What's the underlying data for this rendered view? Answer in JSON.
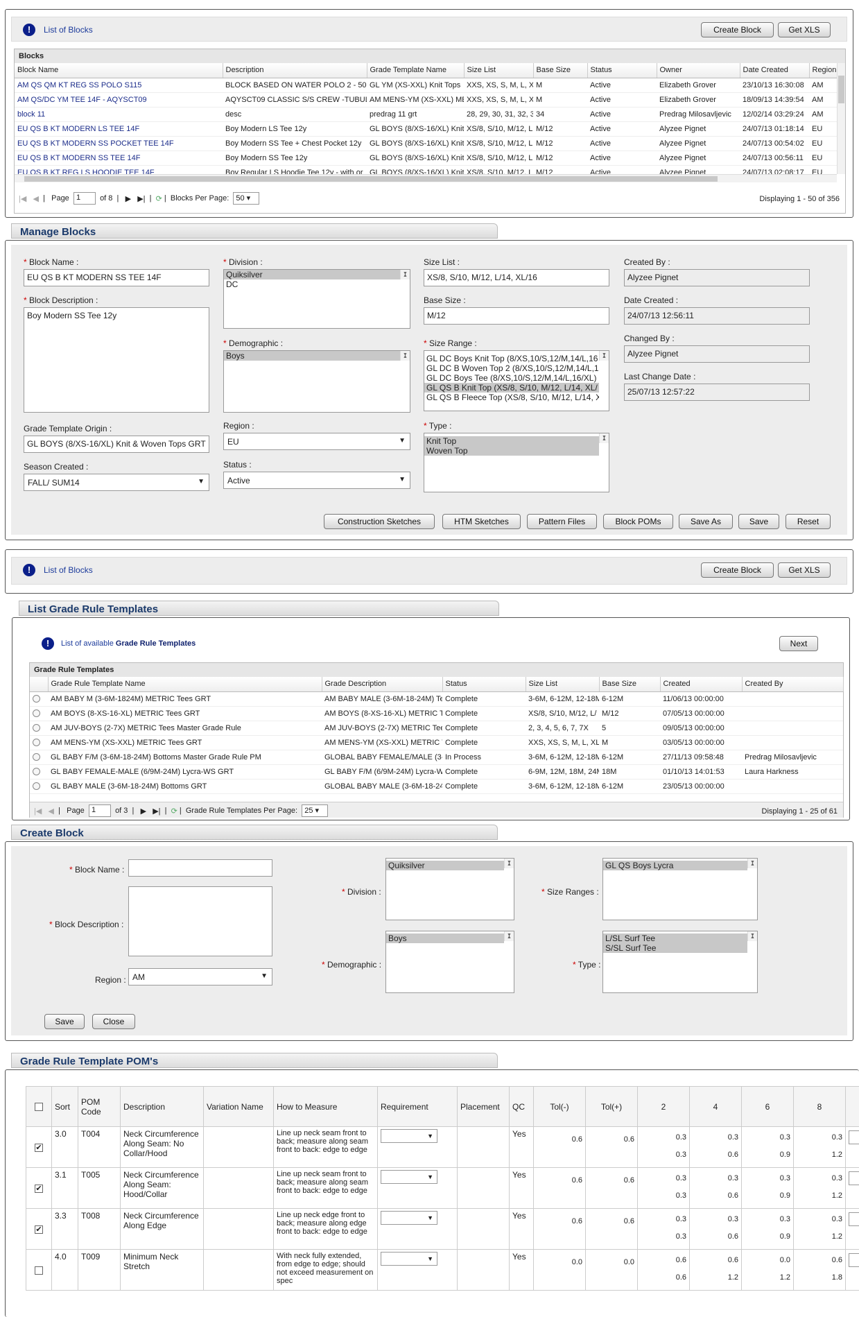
{
  "list_blocks": {
    "title_prefix": "List of ",
    "title_bold": "Blocks",
    "create_btn": "Create Block",
    "xls_btn": "Get XLS",
    "grid_title": "Blocks",
    "columns": [
      "Block Name",
      "Description",
      "Grade Template Name",
      "Size List",
      "Base Size",
      "Status",
      "Owner",
      "Date Created",
      "Region"
    ],
    "rows": [
      [
        "AM QS QM KT REG SS POLO S115",
        "BLOCK BASED ON WATER POLO 2 - 5086",
        "GL YM (XS-XXL) Knit Tops",
        "XXS, XS, S, M, L, X",
        "M",
        "Active",
        "Elizabeth Grover",
        "23/10/13 16:30:08",
        "AM"
      ],
      [
        "AM QS/DC YM TEE 14F - AQYSCT09",
        "AQYSCT09 CLASSIC S/S CREW -TUBULA",
        "AM MENS-YM (XS-XXL) ME",
        "XXS, XS, S, M, L, X",
        "M",
        "Active",
        "Elizabeth Grover",
        "18/09/13 14:39:54",
        "AM"
      ],
      [
        "block 11",
        "desc",
        "predrag 11 grt",
        "28, 29, 30, 31, 32, 3",
        "34",
        "Active",
        "Predrag Milosavljevic",
        "12/02/14 03:29:24",
        "AM"
      ],
      [
        "EU QS B KT MODERN LS TEE 14F",
        "Boy Modern LS Tee 12y",
        "GL BOYS (8/XS-16/XL) Knit",
        "XS/8, S/10, M/12, L",
        "M/12",
        "Active",
        "Alyzee Pignet",
        "24/07/13 01:18:14",
        "EU"
      ],
      [
        "EU QS B KT MODERN SS POCKET TEE 14F",
        "Boy Modern SS Tee + Chest Pocket 12y",
        "GL BOYS (8/XS-16/XL) Knit",
        "XS/8, S/10, M/12, L",
        "M/12",
        "Active",
        "Alyzee Pignet",
        "24/07/13 00:54:02",
        "EU"
      ],
      [
        "EU QS B KT MODERN SS TEE 14F",
        "Boy Modern SS Tee 12y",
        "GL BOYS (8/XS-16/XL) Knit",
        "XS/8, S/10, M/12, L",
        "M/12",
        "Active",
        "Alyzee Pignet",
        "24/07/13 00:56:11",
        "EU"
      ],
      [
        "EU QS B KT REG LS HOODIE TEE 14F",
        "Boy Regular LS Hoodie Tee 12y - with or",
        "GL BOYS (8/XS-16/XL) Knit",
        "XS/8, S/10, M/12, L",
        "M/12",
        "Active",
        "Alyzee Pignet",
        "24/07/13 02:08:17",
        "EU"
      ]
    ],
    "pager": {
      "page_label": "Page",
      "page": "1",
      "of": "of 8",
      "per_page_label": "Blocks Per Page:",
      "per_page": "50",
      "displaying": "Displaying 1 - 50 of 356"
    }
  },
  "manage": {
    "title": "Manage Blocks",
    "block_name_label": "Block Name :",
    "block_name": "EU QS B KT MODERN SS TEE 14F",
    "block_desc_label": "Block Description :",
    "block_desc": "Boy Modern SS Tee 12y",
    "grade_origin_label": "Grade Template Origin :",
    "grade_origin": "GL BOYS (8/XS-16/XL) Knit & Woven Tops GRT",
    "season_label": "Season Created :",
    "season": "FALL/ SUM14",
    "division_label": "Division :",
    "division": [
      "Quiksilver",
      "DC"
    ],
    "demographic_label": "Demographic :",
    "demographic": [
      "Boys"
    ],
    "region_label": "Region :",
    "region": "EU",
    "status_label": "Status :",
    "status": "Active",
    "size_list_label": "Size List :",
    "size_list": "XS/8, S/10, M/12, L/14, XL/16",
    "base_size_label": "Base Size :",
    "base_size": "M/12",
    "size_range_label": "Size Range :",
    "size_range": [
      "GL DC Boys Knit Top (8/XS,10/S,12/M,14/L,16",
      "GL DC B Woven Top 2 (8/XS,10/S,12/M,14/L,1",
      "GL DC Boys Tee (8/XS,10/S,12/M,14/L,16/XL)",
      "GL QS B Knit Top (XS/8, S/10, M/12, L/14, XL/",
      "GL QS B Fleece Top (XS/8, S/10, M/12, L/14, X"
    ],
    "type_label": "Type :",
    "type": [
      "Knit Top",
      "Woven Top"
    ],
    "created_by_label": "Created By :",
    "created_by": "Alyzee Pignet",
    "date_created_label": "Date Created :",
    "date_created": "24/07/13 12:56:11",
    "changed_by_label": "Changed By :",
    "changed_by": "Alyzee Pignet",
    "last_change_label": "Last Change Date :",
    "last_change": "25/07/13 12:57:22",
    "buttons": [
      "Construction Sketches",
      "HTM Sketches",
      "Pattern Files",
      "Block POMs",
      "Save As",
      "Save",
      "Reset"
    ]
  },
  "list_blocks2": {
    "title_prefix": "List of ",
    "title_bold": "Blocks",
    "create_btn": "Create Block",
    "xls_btn": "Get XLS"
  },
  "grt": {
    "title": "List Grade Rule Templates",
    "info_prefix": "List of available ",
    "info_bold": "Grade Rule Templates",
    "next_btn": "Next",
    "grid_title": "Grade Rule Templates",
    "columns": [
      "Grade Rule Template Name",
      "Grade Description",
      "Status",
      "Size List",
      "Base Size",
      "Created",
      "Created By"
    ],
    "rows": [
      [
        "AM BABY M (3-6M-1824M) METRIC Tees GRT",
        "AM BABY MALE (3-6M-18-24M) Tee",
        "Complete",
        "3-6M, 6-12M, 12-18M",
        "6-12M",
        "11/06/13 00:00:00",
        ""
      ],
      [
        "AM BOYS (8-XS-16-XL) METRIC Tees GRT",
        "AM BOYS (8-XS-16-XL) METRIC Tee",
        "Complete",
        "XS/8, S/10, M/12, L/",
        "M/12",
        "07/05/13 00:00:00",
        ""
      ],
      [
        "AM JUV-BOYS (2-7X) METRIC Tees Master Grade Rule",
        "AM JUV-BOYS (2-7X) METRIC Tee",
        "Complete",
        "2, 3, 4, 5, 6, 7, 7X",
        "5",
        "09/05/13 00:00:00",
        ""
      ],
      [
        "AM MENS-YM (XS-XXL) METRIC Tees GRT",
        "AM MENS-YM (XS-XXL) METRIC Te",
        "Complete",
        "XXS, XS, S, M, L, XL,",
        "M",
        "03/05/13 00:00:00",
        ""
      ],
      [
        "GL BABY F/M (3-6M-18-24M) Bottoms Master Grade Rule PM",
        "GLOBAL BABY FEMALE/MALE (3-6",
        "In Process",
        "3-6M, 6-12M, 12-18M",
        "6-12M",
        "27/11/13 09:58:48",
        "Predrag Milosavljevic"
      ],
      [
        "GL BABY FEMALE-MALE (6/9M-24M) Lycra-WS GRT",
        "GL BABY F/M (6/9M-24M) Lycra-W",
        "Complete",
        "6-9M, 12M, 18M, 24M",
        "18M",
        "01/10/13 14:01:53",
        "Laura Harkness"
      ],
      [
        "GL BABY MALE (3-6M-18-24M) Bottoms GRT",
        "GLOBAL BABY MALE (3-6M-18-24M",
        "Complete",
        "3-6M, 6-12M, 12-18M",
        "6-12M",
        "23/05/13 00:00:00",
        ""
      ]
    ],
    "pager": {
      "page_label": "Page",
      "page": "1",
      "of": "of 3",
      "per_page_label": "Grade Rule Templates Per Page:",
      "per_page": "25",
      "displaying": "Displaying 1 - 25 of 61"
    }
  },
  "create": {
    "title": "Create Block",
    "block_name_label": "Block Name :",
    "block_desc_label": "Block Description :",
    "region_label": "Region :",
    "region": "AM",
    "division_label": "Division :",
    "division": [
      "Quiksilver"
    ],
    "demographic_label": "Demographic :",
    "demographic": [
      "Boys"
    ],
    "size_ranges_label": "Size Ranges :",
    "size_ranges": [
      "GL QS Boys Lycra"
    ],
    "type_label": "Type :",
    "type": [
      "L/SL Surf Tee",
      "S/SL Surf Tee"
    ],
    "save_btn": "Save",
    "close_btn": "Close"
  },
  "pom": {
    "title": "Grade Rule Template POM's",
    "columns": [
      "Sort",
      "POM Code",
      "Description",
      "Variation Name",
      "How to Measure",
      "Requirement",
      "Placement",
      "QC",
      "Tol(-)",
      "Tol(+)",
      "2",
      "4",
      "6",
      "8"
    ],
    "rows": [
      {
        "checked": true,
        "sort": "3.0",
        "code": "T004",
        "desc": "Neck Circumference Along Seam: No Collar/Hood",
        "how": "Line up neck seam front to back; measure along seam front to back: edge to edge",
        "qc": "Yes",
        "tolm": "0.6",
        "tolp": "0.6",
        "g": [
          [
            "0.3",
            "0.3"
          ],
          [
            "0.3",
            "0.6"
          ],
          [
            "0.3",
            "0.9"
          ],
          [
            "0.3",
            "1.2"
          ]
        ]
      },
      {
        "checked": true,
        "sort": "3.1",
        "code": "T005",
        "desc": "Neck Circumference Along Seam: Hood/Collar",
        "how": "Line up neck seam front to back; measure along seam front to back: edge to edge",
        "qc": "Yes",
        "tolm": "0.6",
        "tolp": "0.6",
        "g": [
          [
            "0.3",
            "0.3"
          ],
          [
            "0.3",
            "0.6"
          ],
          [
            "0.3",
            "0.9"
          ],
          [
            "0.3",
            "1.2"
          ]
        ]
      },
      {
        "checked": true,
        "sort": "3.3",
        "code": "T008",
        "desc": "Neck Circumference Along Edge",
        "how": "Line up neck edge front to back; measure along edge front to back: edge to edge",
        "qc": "Yes",
        "tolm": "0.6",
        "tolp": "0.6",
        "g": [
          [
            "0.3",
            "0.3"
          ],
          [
            "0.3",
            "0.6"
          ],
          [
            "0.3",
            "0.9"
          ],
          [
            "0.3",
            "1.2"
          ]
        ]
      },
      {
        "checked": false,
        "sort": "4.0",
        "code": "T009",
        "desc": "Minimum Neck Stretch",
        "how": "With neck fully extended, from edge to edge; should not exceed measurement on spec",
        "qc": "Yes",
        "tolm": "0.0",
        "tolp": "0.0",
        "g": [
          [
            "0.6",
            "0.6"
          ],
          [
            "0.6",
            "1.2"
          ],
          [
            "0.0",
            "1.2"
          ],
          [
            "0.6",
            "1.8"
          ]
        ]
      }
    ]
  }
}
